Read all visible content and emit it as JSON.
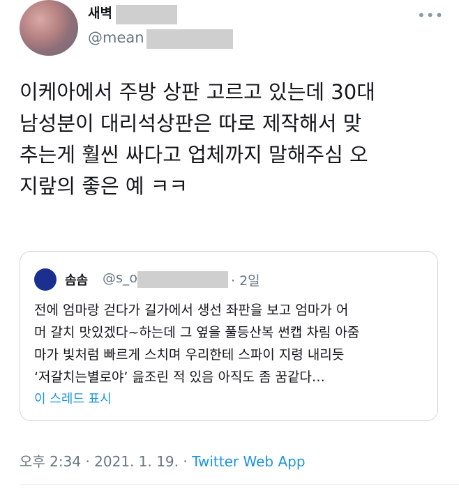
{
  "author": {
    "name": "새벽",
    "handle": "@mean"
  },
  "tweet": {
    "lines": [
      "이케아에서 주방 상판 고르고 있는데 30대",
      "남성분이 대리석상판은 따로 제작해서 맞",
      "추는게 훨씬 싸다고 업체까지 말해주심 오",
      "지랖의 좋은 예 ㅋㅋ"
    ]
  },
  "quote": {
    "name": "솜솜",
    "handle": "@s_o",
    "time": "· 2일",
    "lines": [
      "전에 엄마랑 걷다가 길가에서 생선 좌판을 보고 엄마가 어",
      "머 갈치 맛있겠다~하는데 그 옆을 풀등산복 썬캡 차림 아줌",
      "마가 빛처럼 빠르게 스치며 우리한테 스파이 지령 내리듯",
      "‘저갈치는별로야’ 읊조린 적 있음 아직도 좀 꿈같다…"
    ],
    "show_thread": "이 스레드 표시"
  },
  "meta": {
    "time": "오후 2:34",
    "date": "2021. 1. 19.",
    "app": "Twitter Web App"
  },
  "icons": {
    "more": "more-dots-icon"
  },
  "colors": {
    "link": "#1b95e0",
    "secondary_text": "#66757f",
    "redaction": "#cfcfcf"
  }
}
